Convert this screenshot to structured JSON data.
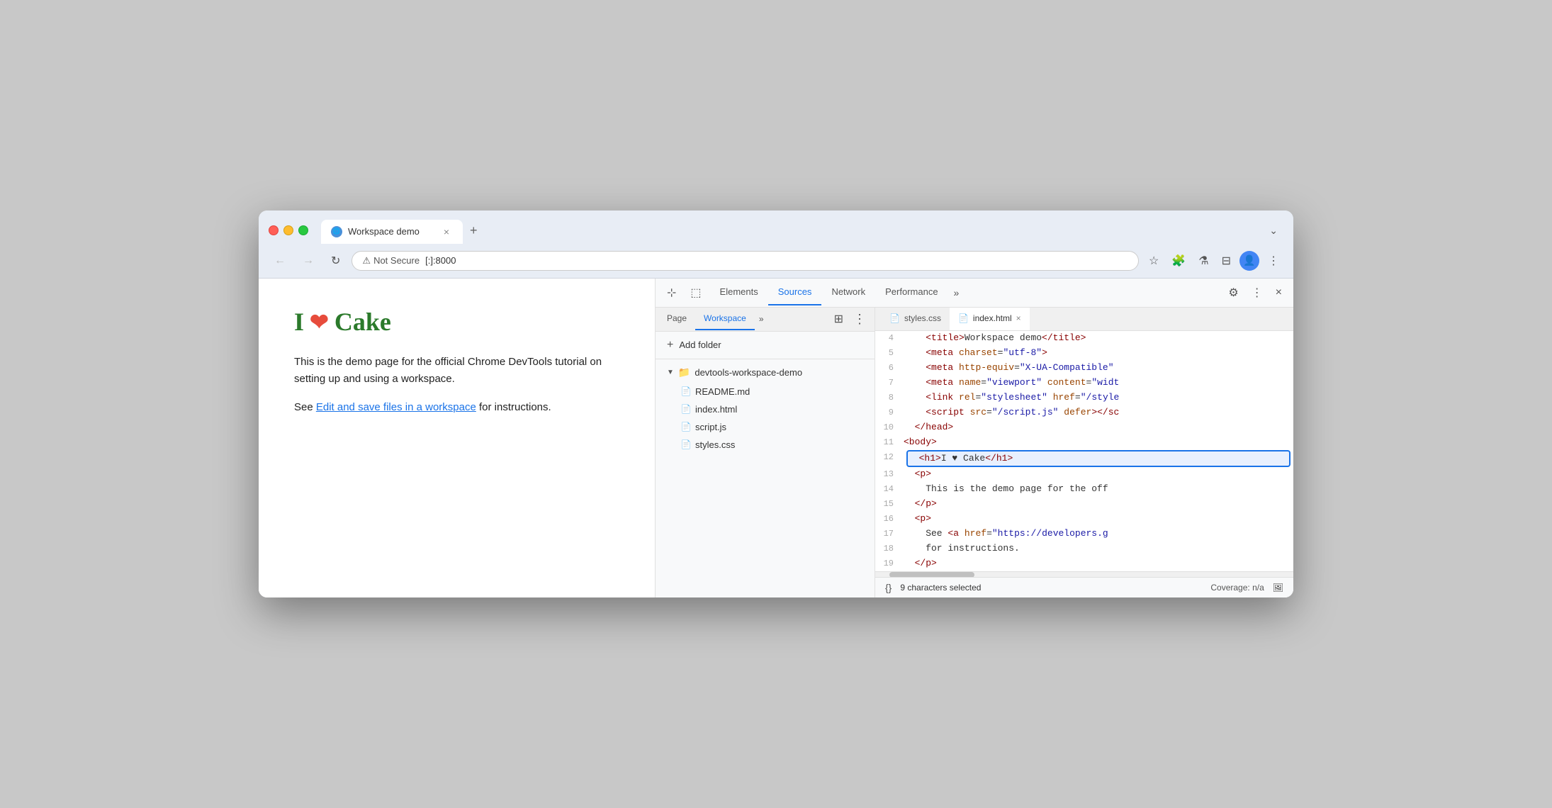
{
  "browser": {
    "tab_title": "Workspace demo",
    "tab_close": "×",
    "tab_new": "+",
    "tab_dropdown": "⌄",
    "url_warning": "⚠",
    "not_secure": "Not Secure",
    "url": "[:]:8000",
    "nav_back": "←",
    "nav_forward": "→",
    "nav_reload": "↻",
    "nav_bookmark": "☆",
    "nav_extensions": "🧩",
    "nav_lab": "⚗",
    "nav_sidebar": "⊟",
    "nav_more": "⋮"
  },
  "page": {
    "heading": "I ❤ Cake",
    "body_text_1": "This is the demo page for the official Chrome DevTools tutorial on setting up and using a workspace.",
    "body_text_2_pre": "See ",
    "body_link": "Edit and save files in a workspace",
    "body_text_2_post": " for instructions."
  },
  "devtools": {
    "tabs": [
      {
        "label": "Elements",
        "active": false
      },
      {
        "label": "Sources",
        "active": true
      },
      {
        "label": "Network",
        "active": false
      },
      {
        "label": "Performance",
        "active": false
      }
    ],
    "tab_more": "»",
    "settings_icon": "⚙",
    "more_icon": "⋮",
    "close_icon": "×",
    "inspector_icon": "⊹",
    "device_icon": "⬚",
    "sources": {
      "nav_tabs": [
        {
          "label": "Page",
          "active": false
        },
        {
          "label": "Workspace",
          "active": true
        }
      ],
      "nav_more": "»",
      "sidebar_icon": "⊞",
      "nav_more_btn": "⋮",
      "add_folder": "+ Add folder",
      "folder_name": "devtools-workspace-demo",
      "files": [
        {
          "name": "README.md",
          "icon_color": "#888"
        },
        {
          "name": "index.html",
          "icon_color": "#888"
        },
        {
          "name": "script.js",
          "icon_color": "#f5a623"
        },
        {
          "name": "styles.css",
          "icon_color": "#a855f7"
        }
      ],
      "open_tabs": [
        {
          "label": "styles.css",
          "active": false
        },
        {
          "label": "index.html",
          "active": true,
          "closeable": true
        }
      ]
    },
    "code_lines": [
      {
        "num": "4",
        "content": "    <title>Workspace demo</title>"
      },
      {
        "num": "5",
        "content": "    <meta charset=\"utf-8\">"
      },
      {
        "num": "6",
        "content": "    <meta http-equiv=\"X-UA-Compatible\""
      },
      {
        "num": "7",
        "content": "    <meta name=\"viewport\" content=\"widt"
      },
      {
        "num": "8",
        "content": "    <link rel=\"stylesheet\" href=\"/style"
      },
      {
        "num": "9",
        "content": "    <script src=\"/script.js\" defer></sc"
      },
      {
        "num": "10",
        "content": "  </head>"
      },
      {
        "num": "11",
        "content": "<body>"
      },
      {
        "num": "12",
        "content": "  <h1>I ♥ Cake</h1>",
        "highlighted": true
      },
      {
        "num": "13",
        "content": "  <p>"
      },
      {
        "num": "14",
        "content": "    This is the demo page for the off"
      },
      {
        "num": "15",
        "content": "  </p>"
      },
      {
        "num": "16",
        "content": "  <p>"
      },
      {
        "num": "17",
        "content": "    See <a href=\"https://developers.g"
      },
      {
        "num": "18",
        "content": "    for instructions."
      },
      {
        "num": "19",
        "content": "  </p>"
      }
    ],
    "statusbar": {
      "braces": "{}",
      "selected_text": "9 characters selected",
      "coverage": "Coverage: n/a",
      "screenshot_icon": "🖼"
    }
  }
}
